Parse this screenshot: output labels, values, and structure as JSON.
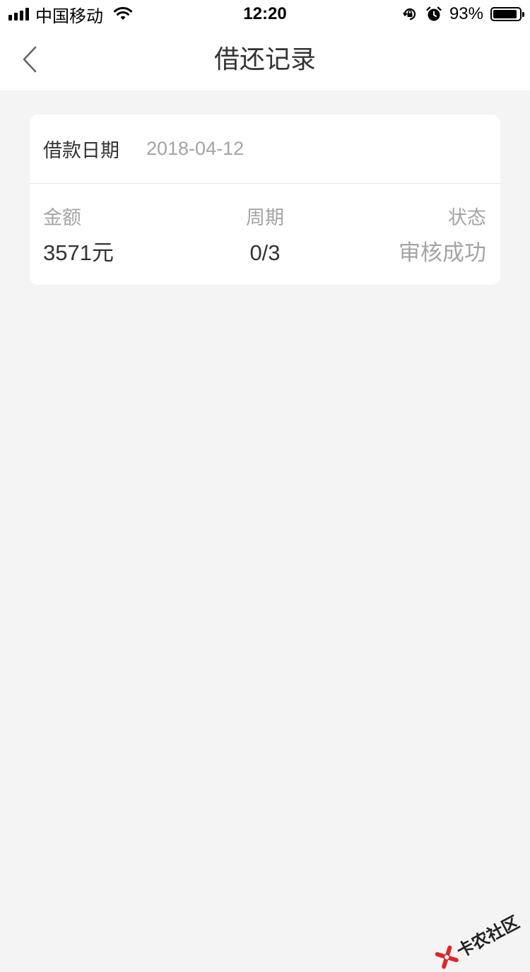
{
  "status_bar": {
    "carrier": "中国移动",
    "time": "12:20",
    "battery_percent": "93%",
    "battery_level": 0.93,
    "icons": [
      "signal-icon",
      "wifi-icon",
      "orientation-lock-icon",
      "alarm-icon",
      "battery-icon"
    ]
  },
  "nav": {
    "title": "借还记录",
    "back_icon": "chevron-left-icon"
  },
  "record": {
    "date_label": "借款日期",
    "date_value": "2018-04-12",
    "amount_label": "金额",
    "amount_value": "3571元",
    "period_label": "周期",
    "period_value": "0/3",
    "status_label": "状态",
    "status_value": "审核成功"
  },
  "watermark": {
    "text": "卡农社区",
    "color": "#e0262b"
  },
  "colors": {
    "background": "#f4f4f4",
    "card": "#ffffff",
    "text_primary": "#333333",
    "text_secondary": "#a4a4a4"
  }
}
